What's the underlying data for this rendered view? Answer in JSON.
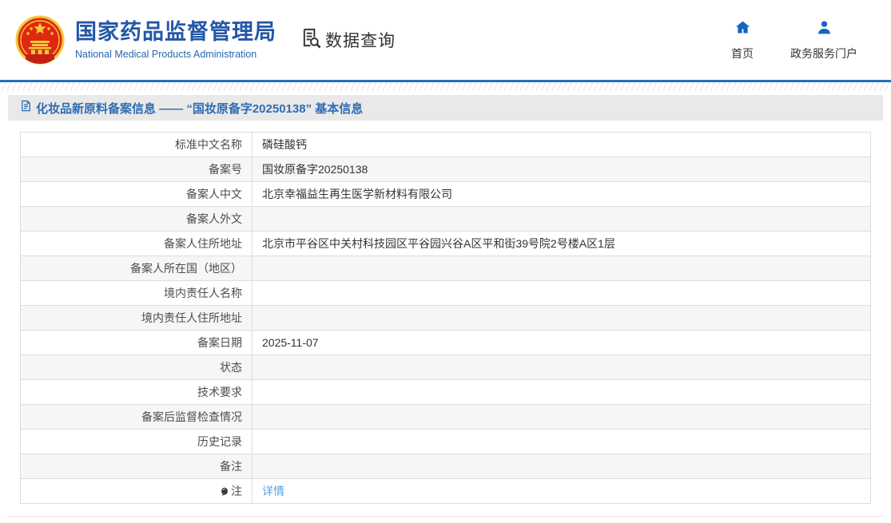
{
  "header": {
    "org_name_zh": "国家药品监督管理局",
    "org_name_en": "National Medical Products Administration",
    "data_query_label": "数据查询",
    "nav": {
      "home": {
        "label": "首页"
      },
      "portal": {
        "label": "政务服务门户"
      }
    }
  },
  "page": {
    "title": "化妆品新原料备案信息 —— “国妆原备字20250138” 基本信息"
  },
  "table": {
    "rows": [
      {
        "label": "标准中文名称",
        "value": "磷硅酸钙"
      },
      {
        "label": "备案号",
        "value": "国妆原备字20250138"
      },
      {
        "label": "备案人中文",
        "value": "北京幸福益生再生医学新材料有限公司"
      },
      {
        "label": "备案人外文",
        "value": ""
      },
      {
        "label": "备案人住所地址",
        "value": "北京市平谷区中关村科技园区平谷园兴谷A区平和街39号院2号楼A区1层"
      },
      {
        "label": "备案人所在国（地区）",
        "value": ""
      },
      {
        "label": "境内责任人名称",
        "value": ""
      },
      {
        "label": "境内责任人住所地址",
        "value": ""
      },
      {
        "label": "备案日期",
        "value": "2025-11-07"
      },
      {
        "label": "状态",
        "value": ""
      },
      {
        "label": "技术要求",
        "value": ""
      },
      {
        "label": "备案后监督检查情况",
        "value": ""
      },
      {
        "label": "历史记录",
        "value": ""
      },
      {
        "label": "备注",
        "value": ""
      },
      {
        "label": "注",
        "value": "",
        "link": "详情",
        "note_icon": true
      }
    ]
  },
  "colors": {
    "brand_blue": "#2357a7",
    "rule_blue": "#2270c2",
    "title_blue": "#2f6db4",
    "link_blue": "#54a0e0",
    "icon_blue": "#1565c0",
    "emblem_red": "#de2910",
    "emblem_gold": "#f5c83c",
    "titlebar_gray": "#e9e9e9",
    "row_stripe_gray": "#f6f6f6"
  }
}
